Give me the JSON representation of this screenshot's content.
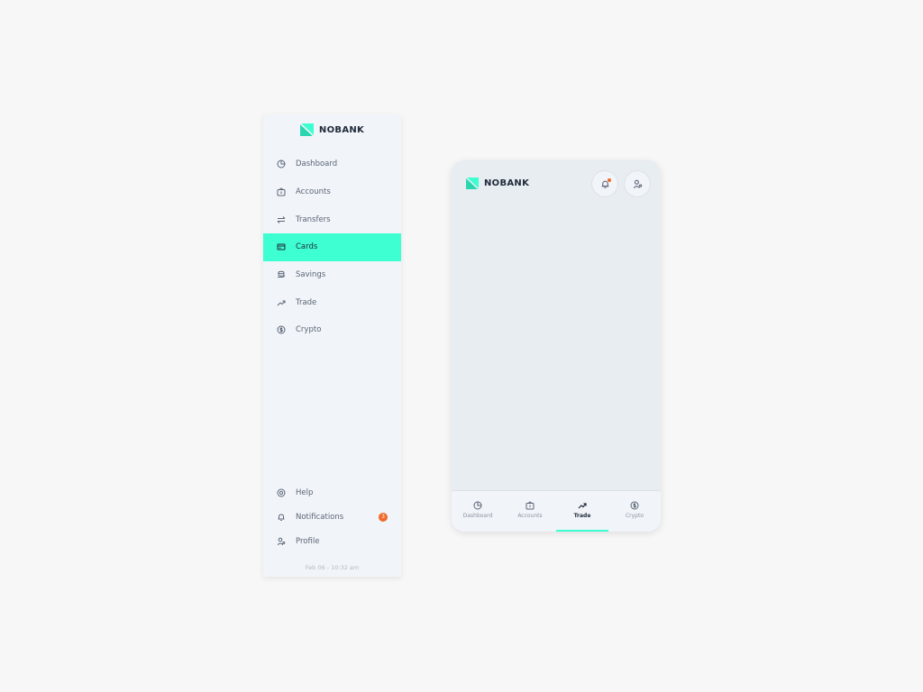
{
  "brand": {
    "name": "NOBANK",
    "accent": "#3dffd2",
    "badge_color": "#f06a2a"
  },
  "sidebar": {
    "items": [
      {
        "label": "Dashboard",
        "icon": "pie-chart-icon"
      },
      {
        "label": "Accounts",
        "icon": "wallet-icon"
      },
      {
        "label": "Transfers",
        "icon": "arrows-icon"
      },
      {
        "label": "Cards",
        "icon": "credit-card-icon",
        "active": true
      },
      {
        "label": "Savings",
        "icon": "coins-icon"
      },
      {
        "label": "Trade",
        "icon": "trend-up-icon"
      },
      {
        "label": "Crypto",
        "icon": "coin-icon"
      }
    ],
    "bottom_items": [
      {
        "label": "Help",
        "icon": "lifebuoy-icon"
      },
      {
        "label": "Notifications",
        "icon": "bell-icon",
        "badge": "3"
      },
      {
        "label": "Profile",
        "icon": "user-icon"
      }
    ],
    "timestamp": "Feb 06 - 10:32 am"
  },
  "mobile": {
    "tabs": [
      {
        "label": "Dashboard",
        "icon": "pie-chart-icon"
      },
      {
        "label": "Accounts",
        "icon": "wallet-icon"
      },
      {
        "label": "Trade",
        "icon": "trend-up-icon",
        "active": true
      },
      {
        "label": "Crypto",
        "icon": "coin-icon"
      }
    ]
  }
}
